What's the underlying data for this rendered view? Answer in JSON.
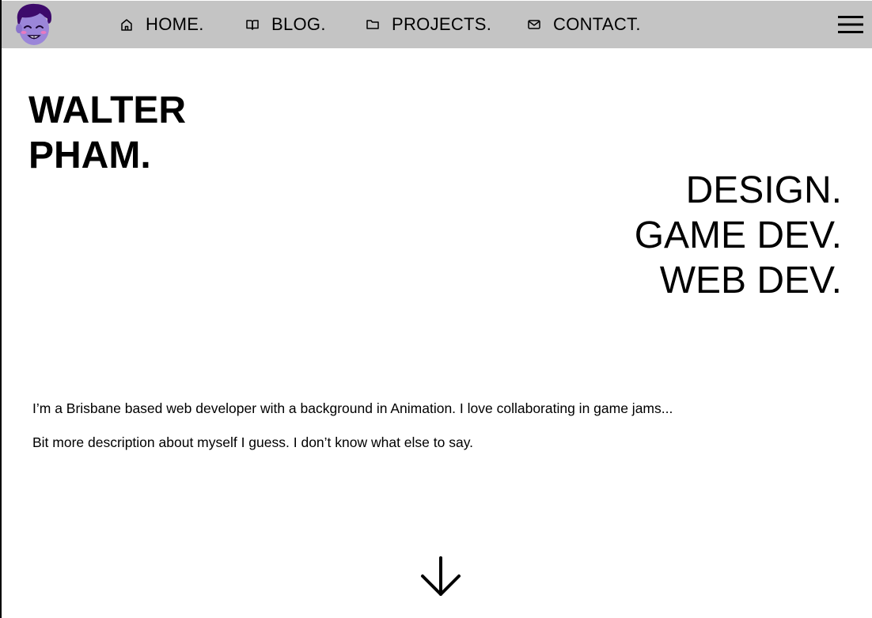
{
  "nav": {
    "items": [
      {
        "label": "HOME.",
        "icon": "home-icon"
      },
      {
        "label": "BLOG.",
        "icon": "book-icon"
      },
      {
        "label": "PROJECTS.",
        "icon": "folder-icon"
      },
      {
        "label": "CONTACT.",
        "icon": "mail-icon"
      }
    ],
    "menu_icon": "hamburger-menu-icon",
    "avatar_icon": "avatar-icon",
    "background_color": "#c4c4c4"
  },
  "hero": {
    "name_line1": "WALTER",
    "name_line2": "PHAM.",
    "roles": [
      "DESIGN.",
      "GAME DEV.",
      "WEB DEV."
    ]
  },
  "bio": {
    "paragraphs": [
      "I’m a Brisbane based web developer with a background in Animation. I love collaborating in game jams...",
      "Bit more description about myself I guess. I don’t know what else to say."
    ]
  },
  "scroll": {
    "icon": "arrow-down-icon"
  },
  "colors": {
    "avatar_skin": "#9b86d9",
    "avatar_hair": "#3d0a6b",
    "avatar_blush": "#e87ac0"
  }
}
